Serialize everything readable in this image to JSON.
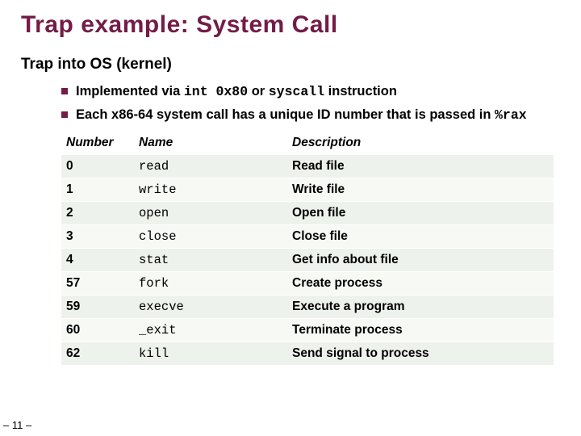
{
  "title": "Trap example: System Call",
  "subtitle": "Trap into OS (kernel)",
  "bullets": {
    "b1_pre": "Implemented via ",
    "b1_code": "int 0x80",
    "b1_mid": " or ",
    "b1_code2": "syscall",
    "b1_post": " instruction",
    "b2_pre": "Each x86-64 system call has a unique ID number that is passed in ",
    "b2_code": "%rax"
  },
  "table": {
    "headers": {
      "num": "Number",
      "name": "Name",
      "desc": "Description"
    },
    "rows": [
      {
        "num": "0",
        "name": "read",
        "desc": "Read file"
      },
      {
        "num": "1",
        "name": "write",
        "desc": "Write file"
      },
      {
        "num": "2",
        "name": "open",
        "desc": "Open file"
      },
      {
        "num": "3",
        "name": "close",
        "desc": "Close file"
      },
      {
        "num": "4",
        "name": "stat",
        "desc": "Get info about file"
      },
      {
        "num": "57",
        "name": "fork",
        "desc": "Create process"
      },
      {
        "num": "59",
        "name": "execve",
        "desc": "Execute a program"
      },
      {
        "num": "60",
        "name": "_exit",
        "desc": "Terminate process"
      },
      {
        "num": "62",
        "name": "kill",
        "desc": "Send signal to process"
      }
    ]
  },
  "page_number": "– 11 –",
  "chart_data": {
    "type": "table",
    "title": "x86-64 System Call ID numbers",
    "columns": [
      "Number",
      "Name",
      "Description"
    ],
    "rows": [
      [
        0,
        "read",
        "Read file"
      ],
      [
        1,
        "write",
        "Write file"
      ],
      [
        2,
        "open",
        "Open file"
      ],
      [
        3,
        "close",
        "Close file"
      ],
      [
        4,
        "stat",
        "Get info about file"
      ],
      [
        57,
        "fork",
        "Create process"
      ],
      [
        59,
        "execve",
        "Execute a program"
      ],
      [
        60,
        "_exit",
        "Terminate process"
      ],
      [
        62,
        "kill",
        "Send signal to process"
      ]
    ]
  }
}
